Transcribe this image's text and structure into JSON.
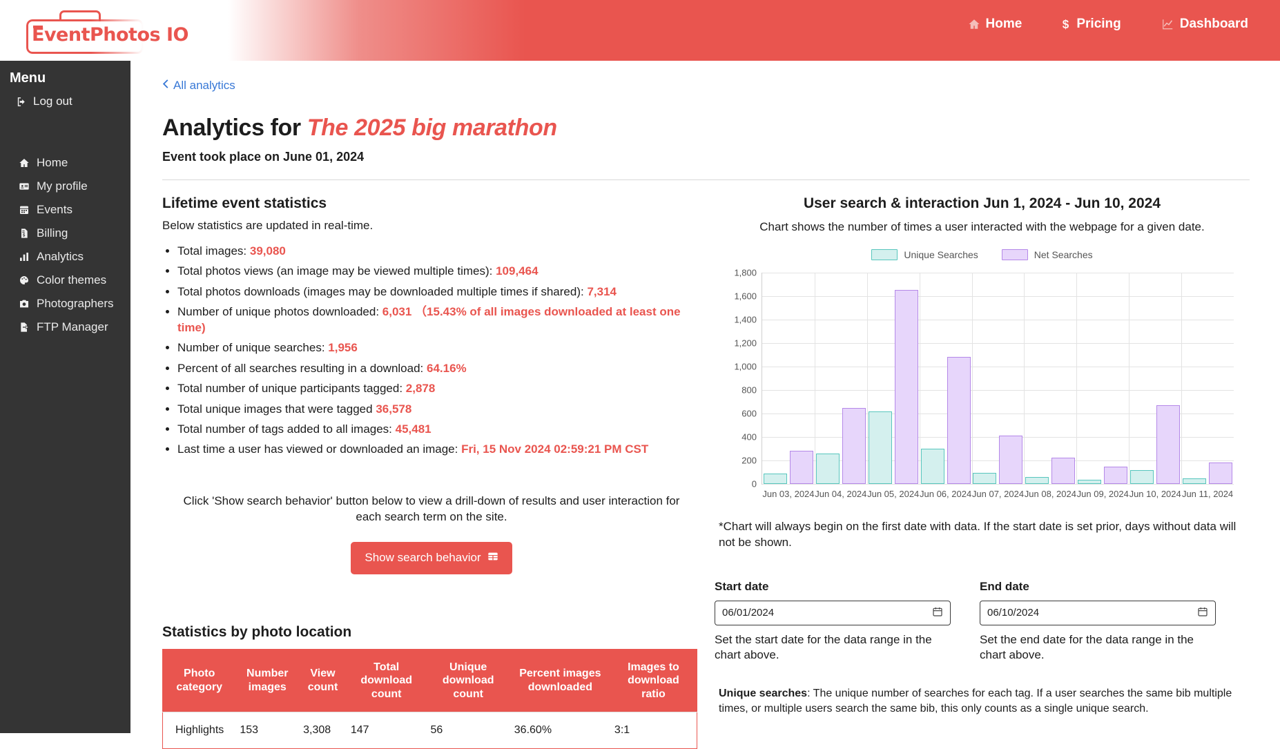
{
  "brand": {
    "logo_text": "EventPhotos IO"
  },
  "nav": [
    {
      "label": "Home",
      "icon": "home-icon"
    },
    {
      "label": "Pricing",
      "icon": "dollar-icon"
    },
    {
      "label": "Dashboard",
      "icon": "chart-line-icon"
    }
  ],
  "sidebar": {
    "title": "Menu",
    "logout": {
      "label": "Log out",
      "icon": "logout-icon"
    },
    "items": [
      {
        "label": "Home",
        "icon": "home-icon"
      },
      {
        "label": "My profile",
        "icon": "id-card-icon"
      },
      {
        "label": "Events",
        "icon": "calendar-icon"
      },
      {
        "label": "Billing",
        "icon": "invoice-icon"
      },
      {
        "label": "Analytics",
        "icon": "bar-chart-icon"
      },
      {
        "label": "Color themes",
        "icon": "palette-icon"
      },
      {
        "label": "Photographers",
        "icon": "camera-icon"
      },
      {
        "label": "FTP Manager",
        "icon": "file-export-icon"
      }
    ]
  },
  "breadcrumb": {
    "label": "All analytics",
    "icon": "chevron-left-icon"
  },
  "page": {
    "title_prefix": "Analytics for ",
    "event_name": "The 2025 big marathon",
    "subtitle": "Event took place on June 01, 2024"
  },
  "lifetime": {
    "heading": "Lifetime event statistics",
    "subheading": "Below statistics are updated in real-time.",
    "items": [
      {
        "label": "Total images: ",
        "value": "39,080",
        "extra": ""
      },
      {
        "label": "Total photos views (an image may be viewed multiple times): ",
        "value": "109,464",
        "extra": ""
      },
      {
        "label": "Total photos downloads (images may be downloaded multiple times if shared): ",
        "value": "7,314",
        "extra": ""
      },
      {
        "label": "Number of unique photos downloaded: ",
        "value": "6,031",
        "extra": "（15.43% of all images downloaded at least one time)"
      },
      {
        "label": "Number of unique searches: ",
        "value": "1,956",
        "extra": ""
      },
      {
        "label": "Percent of all searches resulting in a download: ",
        "value": "64.16%",
        "extra": ""
      },
      {
        "label": "Total number of unique participants tagged: ",
        "value": "2,878",
        "extra": ""
      },
      {
        "label": "Total unique images that were tagged ",
        "value": "36,578",
        "extra": ""
      },
      {
        "label": "Total number of tags added to all images: ",
        "value": "45,481",
        "extra": ""
      },
      {
        "label": "Last time a user has viewed or downloaded an image: ",
        "value": "Fri, 15 Nov 2024 02:59:21 PM CST",
        "extra": ""
      }
    ]
  },
  "behavior": {
    "note": "Click 'Show search behavior' button below to view a drill-down of results and user interaction for each search term on the site.",
    "button_label": "Show search behavior",
    "button_icon": "table-icon"
  },
  "location_stats": {
    "heading": "Statistics by photo location",
    "columns": [
      "Photo category",
      "Number images",
      "View count",
      "Total download count",
      "Unique download count",
      "Percent images downloaded",
      "Images to download ratio"
    ],
    "rows": [
      [
        "Highlights",
        "153",
        "3,308",
        "147",
        "56",
        "36.60%",
        "3:1"
      ]
    ]
  },
  "chart_panel": {
    "note": "*Chart will always begin on the first date with data. If the start date is set prior, days without data will not be shown.",
    "start_date": {
      "label": "Start date",
      "value": "06/01/2024",
      "help": "Set the start date for the data range in the chart above.",
      "icon": "calendar-icon"
    },
    "end_date": {
      "label": "End date",
      "value": "06/10/2024",
      "help": "Set the end date for the data range in the chart above.",
      "icon": "calendar-icon"
    },
    "unique_searches_note_term": "Unique searches",
    "unique_searches_note": ": The unique number of searches for each tag. If a user searches the same bib multiple times, or multiple users search the same bib, this only counts as a single unique search."
  },
  "chart_data": {
    "type": "bar",
    "title": "User search & interaction Jun 1, 2024 - Jun 10, 2024",
    "subtitle": "Chart shows the number of times a user interacted with the webpage for a given date.",
    "xlabel": "",
    "ylabel": "",
    "ylim": [
      0,
      1800
    ],
    "yticks": [
      "0",
      "200",
      "400",
      "600",
      "800",
      "1,000",
      "1,200",
      "1,400",
      "1,600",
      "1,800"
    ],
    "grid": true,
    "legend_position": "top-center",
    "categories": [
      "Jun 03, 2024",
      "Jun 04, 2024",
      "Jun 05, 2024",
      "Jun 06, 2024",
      "Jun 07, 2024",
      "Jun 08, 2024",
      "Jun 09, 2024",
      "Jun 10, 2024",
      "Jun 11, 2024"
    ],
    "series": [
      {
        "name": "Unique Searches",
        "color": "#d4f0ee",
        "border": "#57c6bd",
        "values": [
          90,
          260,
          620,
          300,
          95,
          60,
          35,
          115,
          50
        ]
      },
      {
        "name": "Net Searches",
        "color": "#e7d6fb",
        "border": "#b488e8",
        "values": [
          285,
          645,
          1655,
          1080,
          410,
          225,
          150,
          670,
          180
        ]
      }
    ]
  }
}
